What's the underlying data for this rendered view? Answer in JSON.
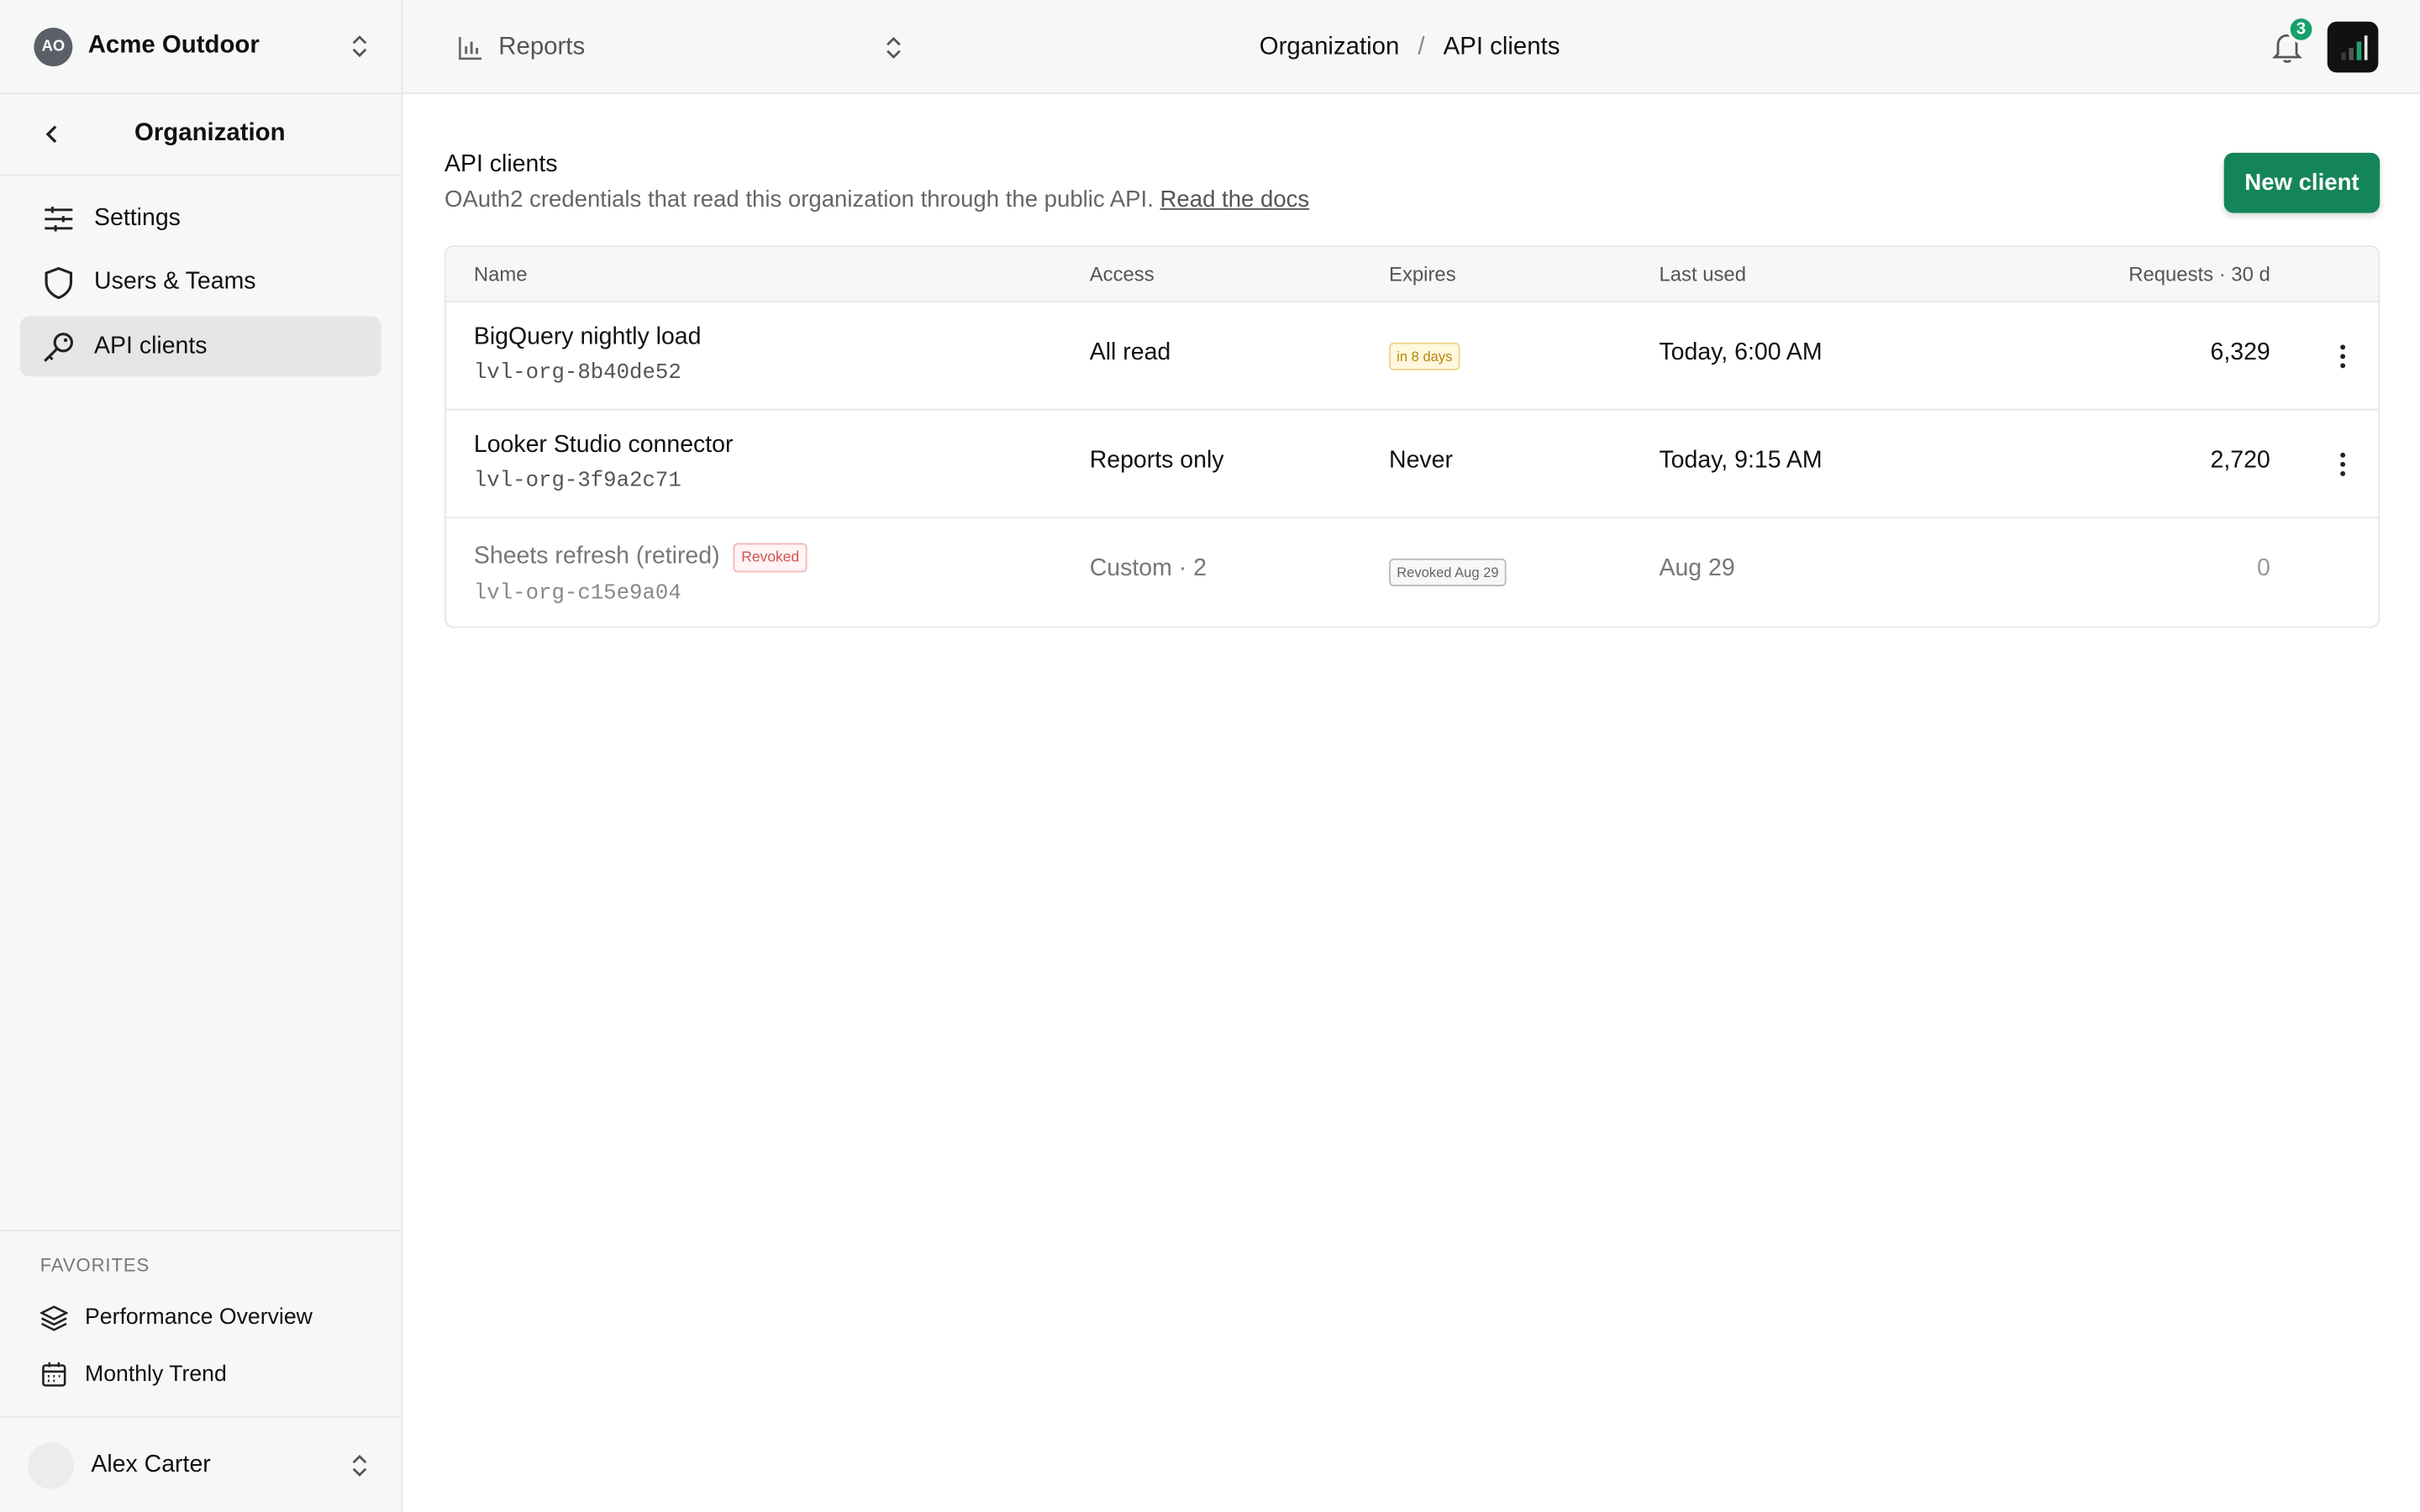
{
  "org": {
    "initials": "AO",
    "name": "Acme Outdoor"
  },
  "report_switcher": {
    "label": "Reports"
  },
  "breadcrumb": {
    "parent": "Organization",
    "separator": "/",
    "current": "API clients"
  },
  "notifications": {
    "count": "3"
  },
  "sidebar": {
    "section_title": "Organization",
    "items": [
      {
        "label": "Settings",
        "icon": "sliders-icon"
      },
      {
        "label": "Users & Teams",
        "icon": "shield-icon"
      },
      {
        "label": "API clients",
        "icon": "key-icon",
        "active": true
      }
    ],
    "favorites_title": "FAVORITES",
    "favorites": [
      {
        "label": "Performance Overview",
        "icon": "layers-icon"
      },
      {
        "label": "Monthly Trend",
        "icon": "calendar-icon"
      }
    ],
    "user": {
      "name": "Alex Carter"
    }
  },
  "page": {
    "title": "API clients",
    "subtitle": "OAuth2 credentials that read this organization through the public API.",
    "docs_link": "Read the docs",
    "new_button": "New client"
  },
  "table": {
    "columns": [
      "Name",
      "Access",
      "Expires",
      "Last used",
      "Requests · 30 d"
    ],
    "rows": [
      {
        "name": "BigQuery nightly load",
        "key": "lvl-org-8b40de52",
        "access": "All read",
        "expires": "in 8 days",
        "last_used": "Today, 6:00 AM",
        "requests": "6,329"
      },
      {
        "name": "Looker Studio connector",
        "key": "lvl-org-3f9a2c71",
        "access": "Reports only",
        "expires": "Never",
        "last_used": "Today, 9:15 AM",
        "requests": "2,720"
      },
      {
        "name": "Sheets refresh (retired)",
        "status": "Revoked",
        "key": "lvl-org-c15e9a04",
        "access": "Custom · 2",
        "expires": "Revoked Aug 29",
        "last_used": "Aug 29",
        "requests": "0"
      }
    ]
  },
  "colors": {
    "accent": "#14855a",
    "badge": "#16a06b",
    "warn": "#b7860a",
    "danger": "#d25555"
  }
}
